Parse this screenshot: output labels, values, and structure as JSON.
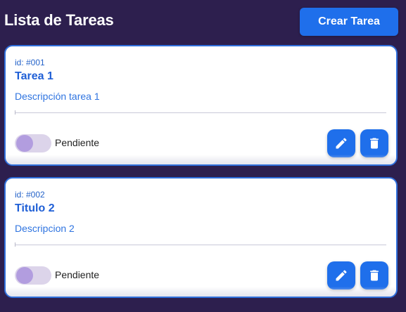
{
  "header": {
    "title": "Lista de Tareas",
    "create_label": "Crear Tarea"
  },
  "colors": {
    "background": "#2d1f4e",
    "accent": "#1f6feb",
    "card_border": "#2f6fdc",
    "toggle_track": "#dcd4ea",
    "toggle_knob": "#b29ddf"
  },
  "tasks": [
    {
      "id_label": "id: #001",
      "title": "Tarea 1",
      "description": "Descripción tarea 1",
      "status": "Pendiente",
      "completed": false,
      "edit_icon": "pencil-icon",
      "delete_icon": "trash-icon"
    },
    {
      "id_label": "id: #002",
      "title": "Titulo 2",
      "description": "Descripcion 2",
      "status": "Pendiente",
      "completed": false,
      "edit_icon": "pencil-icon",
      "delete_icon": "trash-icon"
    }
  ]
}
